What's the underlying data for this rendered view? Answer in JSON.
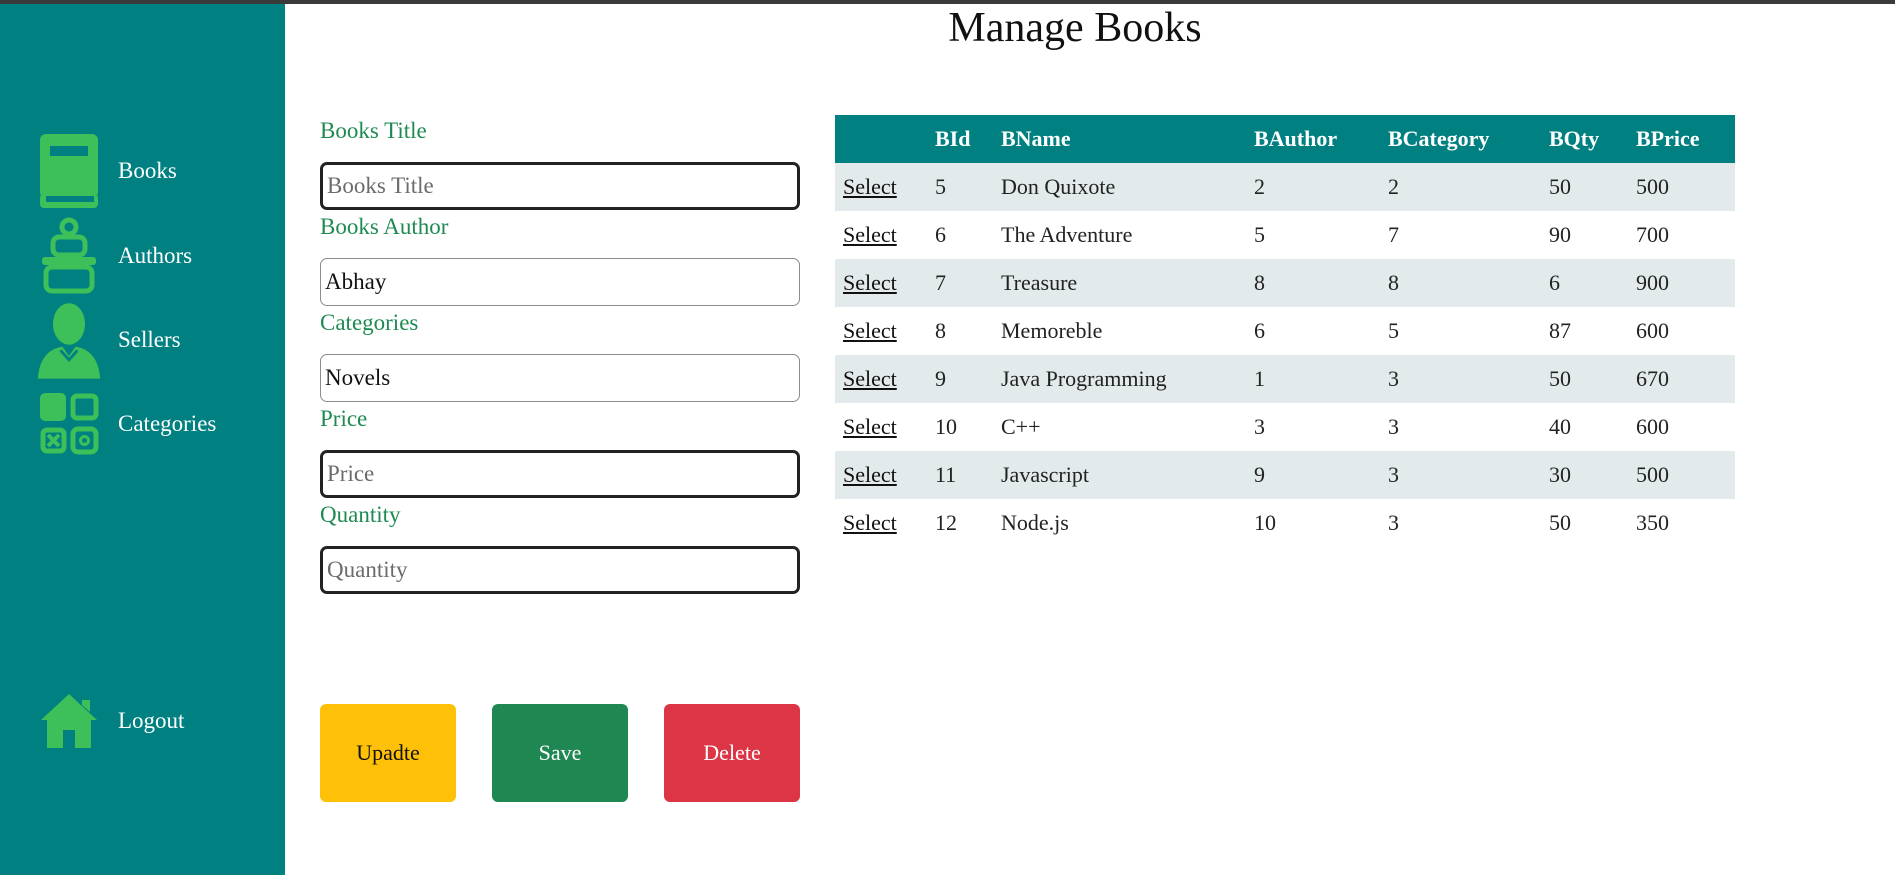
{
  "page": {
    "title": "Manage Books"
  },
  "sidebar": {
    "items": [
      {
        "label": "Books",
        "icon": "book-icon"
      },
      {
        "label": "Authors",
        "icon": "author-icon"
      },
      {
        "label": "Sellers",
        "icon": "seller-icon"
      },
      {
        "label": "Categories",
        "icon": "categories-icon"
      }
    ],
    "logout": {
      "label": "Logout",
      "icon": "home-icon"
    }
  },
  "form": {
    "title": {
      "label": "Books Title",
      "placeholder": "Books Title",
      "value": ""
    },
    "author": {
      "label": "Books Author",
      "placeholder": "",
      "value": "Abhay"
    },
    "category": {
      "label": "Categories",
      "placeholder": "",
      "value": "Novels"
    },
    "price": {
      "label": "Price",
      "placeholder": "Price",
      "value": ""
    },
    "quantity": {
      "label": "Quantity",
      "placeholder": "Quantity",
      "value": ""
    }
  },
  "buttons": {
    "update": "Upadte",
    "save": "Save",
    "delete": "Delete"
  },
  "table": {
    "headers": [
      "",
      "BId",
      "BName",
      "BAuthor",
      "BCategory",
      "BQty",
      "BPrice"
    ],
    "select_label": "Select",
    "rows": [
      [
        "5",
        "Don Quixote",
        "2",
        "2",
        "50",
        "500"
      ],
      [
        "6",
        "The Adventure",
        "5",
        "7",
        "90",
        "700"
      ],
      [
        "7",
        "Treasure",
        "8",
        "8",
        "6",
        "900"
      ],
      [
        "8",
        "Memoreble",
        "6",
        "5",
        "87",
        "600"
      ],
      [
        "9",
        "Java Programming",
        "1",
        "3",
        "50",
        "670"
      ],
      [
        "10",
        "C++",
        "3",
        "3",
        "40",
        "600"
      ],
      [
        "11",
        "Javascript",
        "9",
        "3",
        "30",
        "500"
      ],
      [
        "12",
        "Node.js",
        "10",
        "3",
        "50",
        "350"
      ]
    ]
  },
  "colors": {
    "sidebar": "#008080",
    "icon": "#3dbf5a",
    "label": "#1e8a52",
    "update": "#ffc107",
    "save": "#1f8752",
    "delete": "#dc3545",
    "row_stripe": "#e3eaec"
  }
}
